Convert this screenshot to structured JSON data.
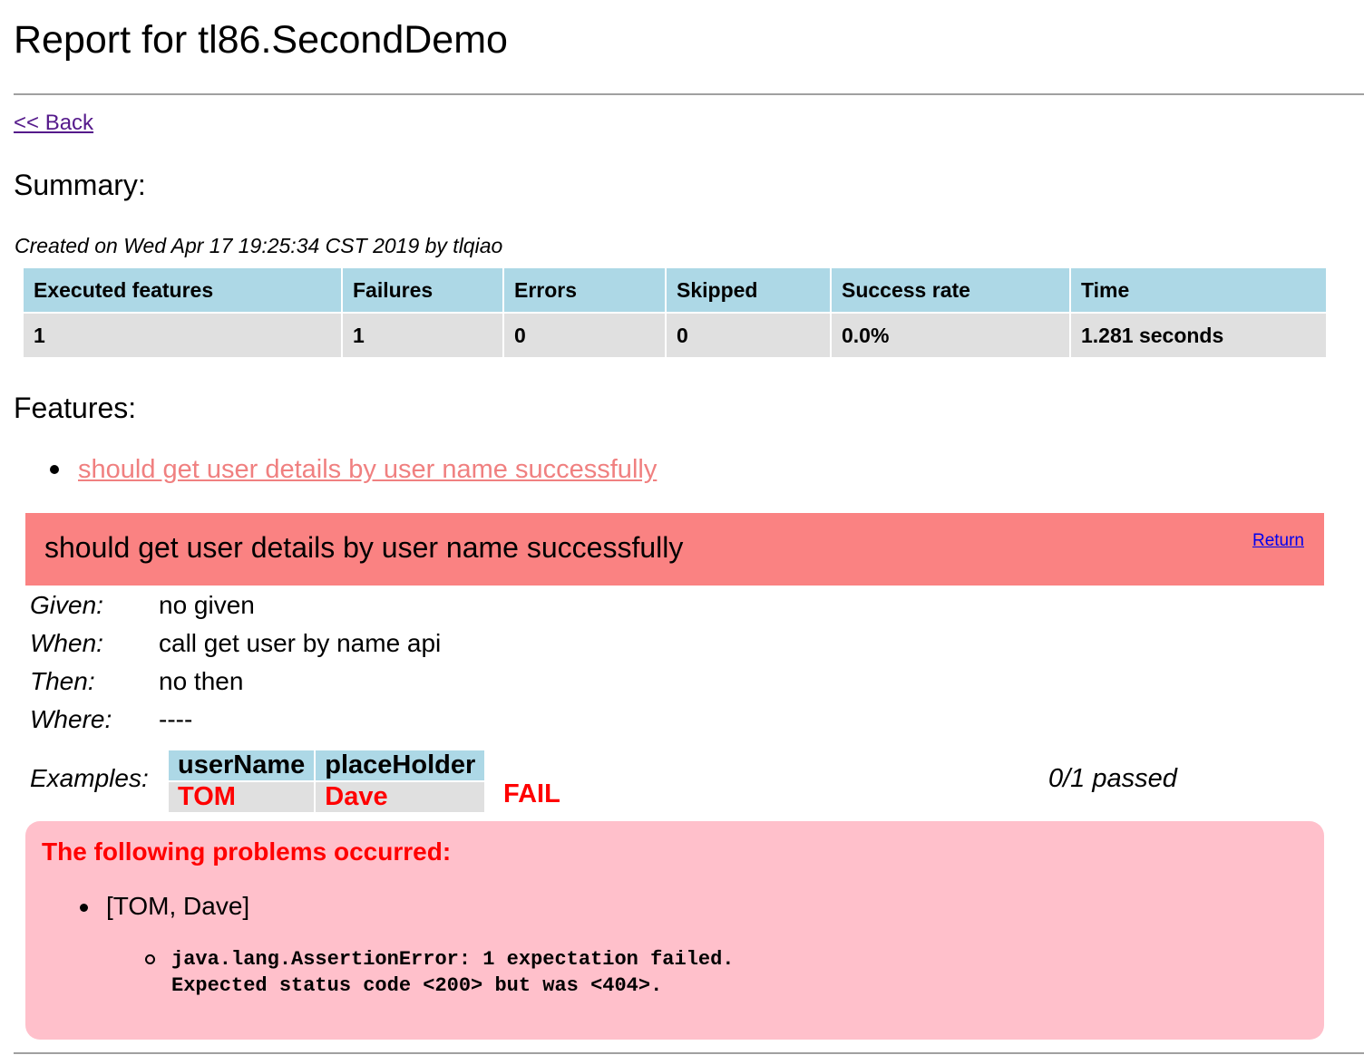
{
  "page_title": "Report for tl86.SecondDemo",
  "back_link": "<< Back",
  "summary": {
    "heading": "Summary:",
    "created": "Created on Wed Apr 17 19:25:34 CST 2019 by tlqiao",
    "headers": [
      "Executed features",
      "Failures",
      "Errors",
      "Skipped",
      "Success rate",
      "Time"
    ],
    "values": [
      "1",
      "1",
      "0",
      "0",
      "0.0%",
      "1.281 seconds"
    ]
  },
  "features": {
    "heading": "Features:",
    "items": [
      "should get user details by user name successfully"
    ]
  },
  "feature": {
    "title": "should get user details by user name successfully",
    "return_link": "Return",
    "blocks": [
      {
        "label": "Given:",
        "text": "no given"
      },
      {
        "label": "When:",
        "text": "call get user by name api"
      },
      {
        "label": "Then:",
        "text": "no then"
      },
      {
        "label": "Where:",
        "text": "----"
      }
    ],
    "examples": {
      "label": "Examples:",
      "headers": [
        "userName",
        "placeHolder"
      ],
      "rows": [
        [
          "TOM",
          "Dave"
        ]
      ],
      "result": "FAIL",
      "passed": "0/1 passed"
    },
    "problems": {
      "title": "The following problems occurred:",
      "item": "[TOM, Dave]",
      "error": "java.lang.AssertionError: 1 expectation failed.\nExpected status code <200> but was <404>."
    }
  },
  "colors": {
    "header_bg": "#add8e6",
    "cell_bg": "#e0e0e0",
    "feature_fail_bg": "#fa8282",
    "problems_bg": "#ffc0cb",
    "fail_text": "#ff0000",
    "feature_link": "#f08080"
  }
}
